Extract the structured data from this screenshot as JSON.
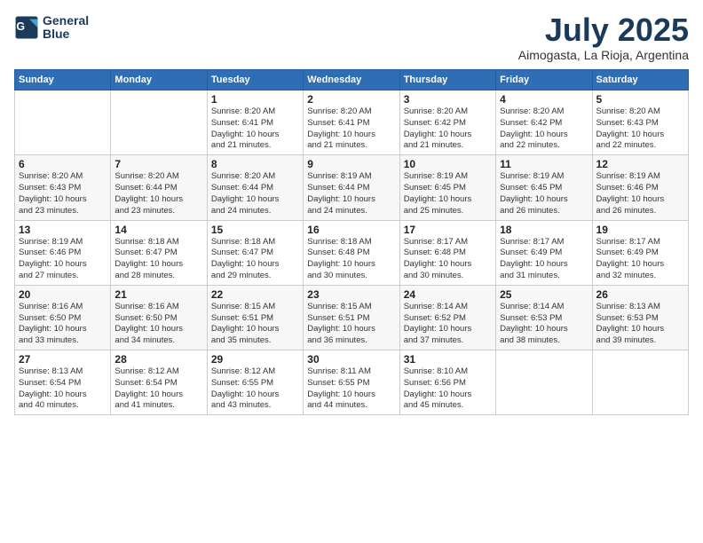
{
  "logo": {
    "line1": "General",
    "line2": "Blue"
  },
  "title": "July 2025",
  "location": "Aimogasta, La Rioja, Argentina",
  "days_of_week": [
    "Sunday",
    "Monday",
    "Tuesday",
    "Wednesday",
    "Thursday",
    "Friday",
    "Saturday"
  ],
  "weeks": [
    [
      {
        "day": "",
        "info": ""
      },
      {
        "day": "",
        "info": ""
      },
      {
        "day": "1",
        "info": "Sunrise: 8:20 AM\nSunset: 6:41 PM\nDaylight: 10 hours\nand 21 minutes."
      },
      {
        "day": "2",
        "info": "Sunrise: 8:20 AM\nSunset: 6:41 PM\nDaylight: 10 hours\nand 21 minutes."
      },
      {
        "day": "3",
        "info": "Sunrise: 8:20 AM\nSunset: 6:42 PM\nDaylight: 10 hours\nand 21 minutes."
      },
      {
        "day": "4",
        "info": "Sunrise: 8:20 AM\nSunset: 6:42 PM\nDaylight: 10 hours\nand 22 minutes."
      },
      {
        "day": "5",
        "info": "Sunrise: 8:20 AM\nSunset: 6:43 PM\nDaylight: 10 hours\nand 22 minutes."
      }
    ],
    [
      {
        "day": "6",
        "info": "Sunrise: 8:20 AM\nSunset: 6:43 PM\nDaylight: 10 hours\nand 23 minutes."
      },
      {
        "day": "7",
        "info": "Sunrise: 8:20 AM\nSunset: 6:44 PM\nDaylight: 10 hours\nand 23 minutes."
      },
      {
        "day": "8",
        "info": "Sunrise: 8:20 AM\nSunset: 6:44 PM\nDaylight: 10 hours\nand 24 minutes."
      },
      {
        "day": "9",
        "info": "Sunrise: 8:19 AM\nSunset: 6:44 PM\nDaylight: 10 hours\nand 24 minutes."
      },
      {
        "day": "10",
        "info": "Sunrise: 8:19 AM\nSunset: 6:45 PM\nDaylight: 10 hours\nand 25 minutes."
      },
      {
        "day": "11",
        "info": "Sunrise: 8:19 AM\nSunset: 6:45 PM\nDaylight: 10 hours\nand 26 minutes."
      },
      {
        "day": "12",
        "info": "Sunrise: 8:19 AM\nSunset: 6:46 PM\nDaylight: 10 hours\nand 26 minutes."
      }
    ],
    [
      {
        "day": "13",
        "info": "Sunrise: 8:19 AM\nSunset: 6:46 PM\nDaylight: 10 hours\nand 27 minutes."
      },
      {
        "day": "14",
        "info": "Sunrise: 8:18 AM\nSunset: 6:47 PM\nDaylight: 10 hours\nand 28 minutes."
      },
      {
        "day": "15",
        "info": "Sunrise: 8:18 AM\nSunset: 6:47 PM\nDaylight: 10 hours\nand 29 minutes."
      },
      {
        "day": "16",
        "info": "Sunrise: 8:18 AM\nSunset: 6:48 PM\nDaylight: 10 hours\nand 30 minutes."
      },
      {
        "day": "17",
        "info": "Sunrise: 8:17 AM\nSunset: 6:48 PM\nDaylight: 10 hours\nand 30 minutes."
      },
      {
        "day": "18",
        "info": "Sunrise: 8:17 AM\nSunset: 6:49 PM\nDaylight: 10 hours\nand 31 minutes."
      },
      {
        "day": "19",
        "info": "Sunrise: 8:17 AM\nSunset: 6:49 PM\nDaylight: 10 hours\nand 32 minutes."
      }
    ],
    [
      {
        "day": "20",
        "info": "Sunrise: 8:16 AM\nSunset: 6:50 PM\nDaylight: 10 hours\nand 33 minutes."
      },
      {
        "day": "21",
        "info": "Sunrise: 8:16 AM\nSunset: 6:50 PM\nDaylight: 10 hours\nand 34 minutes."
      },
      {
        "day": "22",
        "info": "Sunrise: 8:15 AM\nSunset: 6:51 PM\nDaylight: 10 hours\nand 35 minutes."
      },
      {
        "day": "23",
        "info": "Sunrise: 8:15 AM\nSunset: 6:51 PM\nDaylight: 10 hours\nand 36 minutes."
      },
      {
        "day": "24",
        "info": "Sunrise: 8:14 AM\nSunset: 6:52 PM\nDaylight: 10 hours\nand 37 minutes."
      },
      {
        "day": "25",
        "info": "Sunrise: 8:14 AM\nSunset: 6:53 PM\nDaylight: 10 hours\nand 38 minutes."
      },
      {
        "day": "26",
        "info": "Sunrise: 8:13 AM\nSunset: 6:53 PM\nDaylight: 10 hours\nand 39 minutes."
      }
    ],
    [
      {
        "day": "27",
        "info": "Sunrise: 8:13 AM\nSunset: 6:54 PM\nDaylight: 10 hours\nand 40 minutes."
      },
      {
        "day": "28",
        "info": "Sunrise: 8:12 AM\nSunset: 6:54 PM\nDaylight: 10 hours\nand 41 minutes."
      },
      {
        "day": "29",
        "info": "Sunrise: 8:12 AM\nSunset: 6:55 PM\nDaylight: 10 hours\nand 43 minutes."
      },
      {
        "day": "30",
        "info": "Sunrise: 8:11 AM\nSunset: 6:55 PM\nDaylight: 10 hours\nand 44 minutes."
      },
      {
        "day": "31",
        "info": "Sunrise: 8:10 AM\nSunset: 6:56 PM\nDaylight: 10 hours\nand 45 minutes."
      },
      {
        "day": "",
        "info": ""
      },
      {
        "day": "",
        "info": ""
      }
    ]
  ]
}
